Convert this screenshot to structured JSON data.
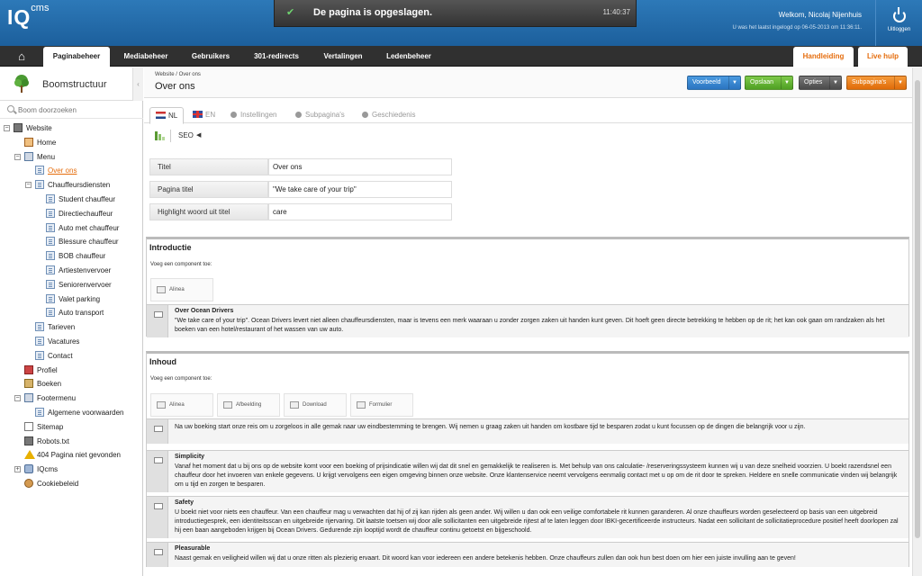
{
  "header": {
    "logo_main": "IQ",
    "logo_sup": "cms",
    "notification": {
      "message": "De pagina is opgeslagen.",
      "time": "11:40:37"
    },
    "welcome": "Welkom, Nicolaj Nijenhuis",
    "last_login": "U was het laatst ingelogd op 06-05-2013 om 11:36:11.",
    "logout_label": "Uitloggen"
  },
  "nav": {
    "items": [
      {
        "label": "Paginabeheer",
        "active": true
      },
      {
        "label": "Mediabeheer"
      },
      {
        "label": "Gebruikers"
      },
      {
        "label": "301-redirects"
      },
      {
        "label": "Vertalingen"
      },
      {
        "label": "Ledenbeheer"
      }
    ],
    "right": [
      {
        "label": "Handleiding"
      },
      {
        "label": "Live hulp"
      }
    ]
  },
  "sidebar": {
    "title": "Boomstructuur",
    "search_placeholder": "Boom doorzoeken",
    "tree": [
      {
        "label": "Website",
        "depth": 0,
        "toggle": "−",
        "icon": "site"
      },
      {
        "label": "Home",
        "depth": 1,
        "icon": "home"
      },
      {
        "label": "Menu",
        "depth": 1,
        "toggle": "−",
        "icon": "menu"
      },
      {
        "label": "Over ons",
        "depth": 2,
        "icon": "page",
        "selected": true
      },
      {
        "label": "Chauffeursdiensten",
        "depth": 2,
        "toggle": "−",
        "icon": "page"
      },
      {
        "label": "Student chauffeur",
        "depth": 3,
        "icon": "page"
      },
      {
        "label": "Directiechauffeur",
        "depth": 3,
        "icon": "page"
      },
      {
        "label": "Auto met chauffeur",
        "depth": 3,
        "icon": "page"
      },
      {
        "label": "Blessure chauffeur",
        "depth": 3,
        "icon": "page"
      },
      {
        "label": "BOB chauffeur",
        "depth": 3,
        "icon": "page"
      },
      {
        "label": "Artiestenvervoer",
        "depth": 3,
        "icon": "page"
      },
      {
        "label": "Seniorenvervoer",
        "depth": 3,
        "icon": "page"
      },
      {
        "label": "Valet parking",
        "depth": 3,
        "icon": "page"
      },
      {
        "label": "Auto transport",
        "depth": 3,
        "icon": "page"
      },
      {
        "label": "Tarieven",
        "depth": 2,
        "icon": "page"
      },
      {
        "label": "Vacatures",
        "depth": 2,
        "icon": "page"
      },
      {
        "label": "Contact",
        "depth": 2,
        "icon": "page"
      },
      {
        "label": "Profiel",
        "depth": 1,
        "icon": "prof"
      },
      {
        "label": "Boeken",
        "depth": 1,
        "icon": "book"
      },
      {
        "label": "Footermenu",
        "depth": 1,
        "toggle": "−",
        "icon": "menu"
      },
      {
        "label": "Algemene voorwaarden",
        "depth": 2,
        "icon": "page"
      },
      {
        "label": "Sitemap",
        "depth": 1,
        "icon": "doc"
      },
      {
        "label": "Robots.txt",
        "depth": 1,
        "icon": "site"
      },
      {
        "label": "404 Pagina niet gevonden",
        "depth": 1,
        "icon": "warn"
      },
      {
        "label": "IQcms",
        "depth": 1,
        "toggle": "+",
        "icon": "iq"
      },
      {
        "label": "Cookiebeleid",
        "depth": 1,
        "icon": "cookie"
      }
    ]
  },
  "page": {
    "breadcrumb": "Website / Over ons",
    "title": "Over ons",
    "buttons": [
      {
        "label": "Voorbeeld",
        "color": "#2a74c0"
      },
      {
        "label": "Opslaan",
        "color": "#4f9f23"
      },
      {
        "label": "Opties",
        "color": "#4a4a4a"
      },
      {
        "label": "Subpagina's",
        "color": "#e06b08"
      }
    ],
    "tabs": [
      {
        "label": "NL",
        "active": true
      },
      {
        "label": "EN"
      },
      {
        "label": "Instellingen"
      },
      {
        "label": "Subpagina's"
      },
      {
        "label": "Geschiedenis"
      }
    ],
    "seo_label": "SEO",
    "fields": [
      {
        "label": "Titel",
        "value": "Over ons"
      },
      {
        "label": "Pagina titel",
        "value": "\"We take care of your trip\""
      },
      {
        "label": "Highlight woord uit titel",
        "value": "care"
      }
    ]
  },
  "sections": {
    "intro": {
      "title": "Introductie",
      "add_label": "Voeg een component toe:",
      "components": [
        "Alinea"
      ],
      "blocks": [
        {
          "title": "Over Ocean Drivers",
          "text": "\"We take care of your trip\". Ocean Drivers levert niet alleen chauffeursdiensten, maar is tevens een merk waaraan u zonder zorgen zaken uit handen kunt geven. Dit hoeft geen directe betrekking te hebben op de rit; het kan ook gaan om randzaken als het boeken van een hotel/restaurant of het wassen van uw auto."
        }
      ]
    },
    "inhoud": {
      "title": "Inhoud",
      "add_label": "Voeg een component toe:",
      "components": [
        "Alinea",
        "Afbeelding",
        "Download",
        "Formulier"
      ],
      "blocks": [
        {
          "title": "",
          "text": "Na uw boeking start onze reis om u zorgeloos in alle gemak naar uw eindbestemming te brengen. Wij nemen u graag zaken uit handen om kostbare tijd te besparen zodat u kunt focussen op de dingen die belangrijk voor u zijn."
        },
        {
          "title": "Simplicity",
          "text": "Vanaf het moment dat u bij ons op de website komt voor een boeking of prijsindicatie willen wij dat dit snel en gemakkelijk te realiseren is. Met behulp van ons calculatie- /reserveringssysteem kunnen wij u van deze snelheid voorzien. U boekt razendsnel een chauffeur door het invoeren van enkele gegevens. U krijgt vervolgens een eigen omgeving binnen onze website. Onze klantenservice neemt vervolgens eenmalig contact met u op om de rit door te spreken. Heldere en snelle communicatie vinden wij belangrijk om u tijd en zorgen te besparen."
        },
        {
          "title": "Safety",
          "text": "U boekt niet voor niets een chauffeur. Van een chauffeur mag u verwachten dat hij of zij kan rijden als geen ander. Wij willen u dan ook een veilige comfortabele rit kunnen garanderen. Al onze chauffeurs worden geselecteerd op basis van een uitgebreid introductiegesprek, een identiteitsscan en uitgebreide rijervaring. Dit laatste toetsen wij door alle sollicitanten een uitgebreide rijtest af te laten leggen door IBKI-gecertificeerde instructeurs. Nadat een sollicitant de sollicitatieprocedure positief heeft doorlopen zal hij een baan aangeboden krijgen bij Ocean Drivers. Gedurende zijn looptijd wordt de chauffeur continu getoetst en bijgeschoold."
        },
        {
          "title": "Pleasurable",
          "text": "Naast gemak en veiligheid willen wij dat u onze ritten als plezierig ervaart. Dit woord kan voor iedereen een andere betekenis hebben. Onze chauffeurs zullen dan ook hun best doen om hier een juiste invulling aan te geven!"
        }
      ]
    }
  }
}
